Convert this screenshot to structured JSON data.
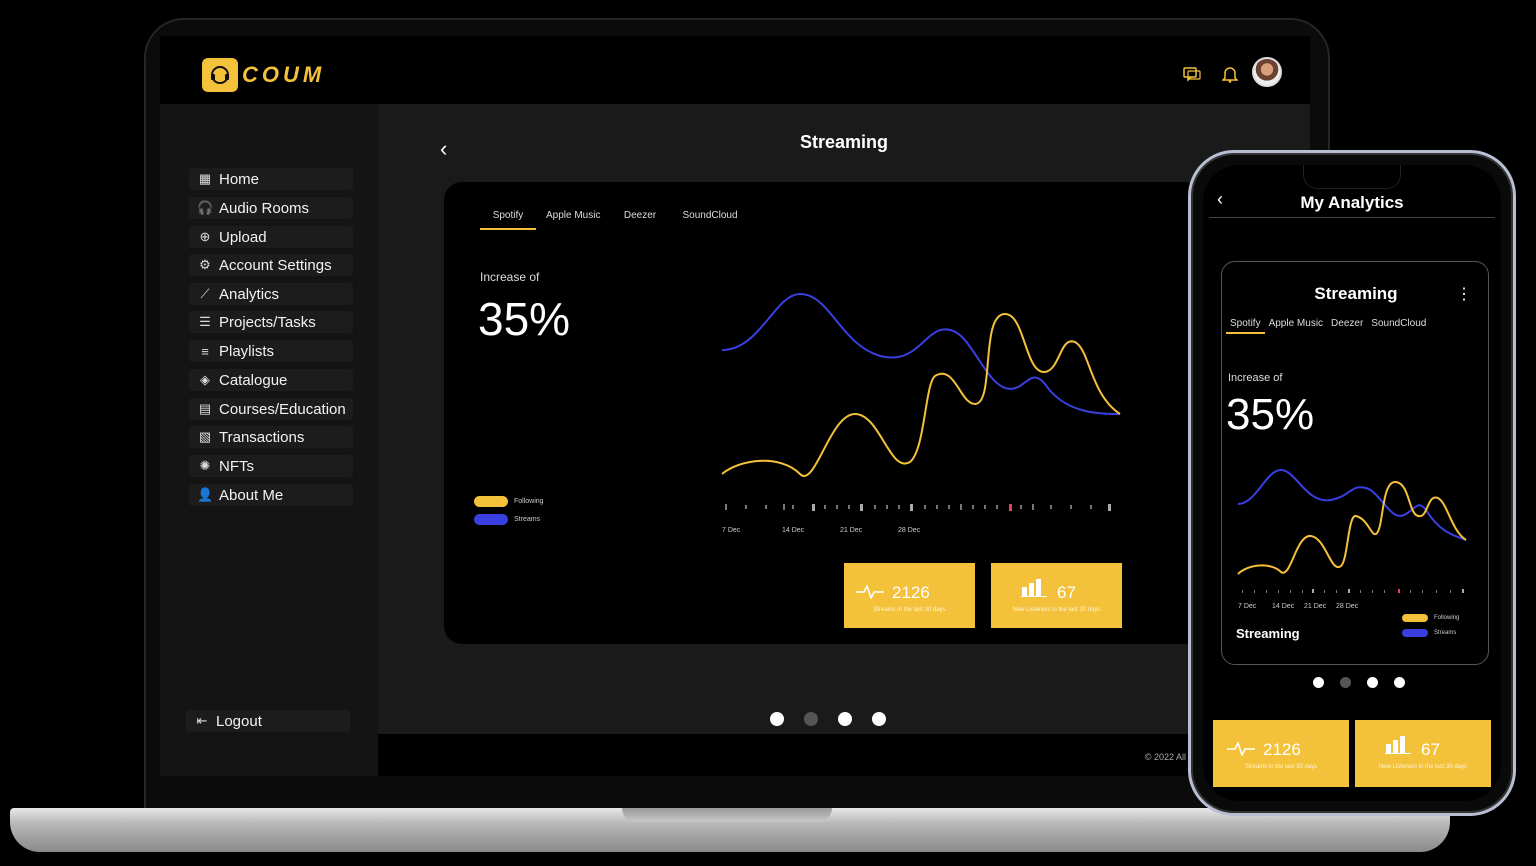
{
  "brand": {
    "name": "COUM"
  },
  "sidebar": {
    "items": [
      {
        "label": "Home",
        "icon": "home-icon",
        "glyph": "▦"
      },
      {
        "label": "Audio Rooms",
        "icon": "headphones-icon",
        "glyph": "🎧"
      },
      {
        "label": "Upload",
        "icon": "plus-circle-icon",
        "glyph": "⊕"
      },
      {
        "label": "Account Settings",
        "icon": "sliders-icon",
        "glyph": "⚙"
      },
      {
        "label": "Analytics",
        "icon": "trend-line-icon",
        "glyph": "⟋"
      },
      {
        "label": "Projects/Tasks",
        "icon": "tasks-icon",
        "glyph": "☰"
      },
      {
        "label": "Playlists",
        "icon": "playlist-icon",
        "glyph": "≡"
      },
      {
        "label": "Catalogue",
        "icon": "diamond-icon",
        "glyph": "◈"
      },
      {
        "label": "Courses/Education",
        "icon": "book-icon",
        "glyph": "▤"
      },
      {
        "label": "Transactions",
        "icon": "transactions-icon",
        "glyph": "▧"
      },
      {
        "label": "NFTs",
        "icon": "nft-icon",
        "glyph": "✺"
      },
      {
        "label": "About Me",
        "icon": "user-icon",
        "glyph": "👤"
      }
    ],
    "logout": "Logout"
  },
  "page": {
    "title": "Streaming"
  },
  "tabs": [
    "Spotify",
    "Apple Music",
    "Deezer",
    "SoundCloud"
  ],
  "active_tab": "Spotify",
  "increase_label": "Increase of",
  "increase_value": "35%",
  "legend": {
    "following": "Following",
    "streams": "Streams"
  },
  "timeline_labels": [
    "7 Dec",
    "14 Dec",
    "21 Dec",
    "28 Dec"
  ],
  "stats": {
    "streams": {
      "value": "2126",
      "label": "Streams in the last 30 days"
    },
    "listeners": {
      "value": "67",
      "label": "New Listeners in the last 30 days"
    }
  },
  "footer": {
    "copyright": "© 2022 All"
  },
  "phone": {
    "title": "My Analytics",
    "card_title": "Streaming",
    "bottom_label": "Streaming"
  },
  "colors": {
    "accent": "#f4c13a",
    "streams": "#3a3fe0",
    "following": "#f4c13a"
  }
}
